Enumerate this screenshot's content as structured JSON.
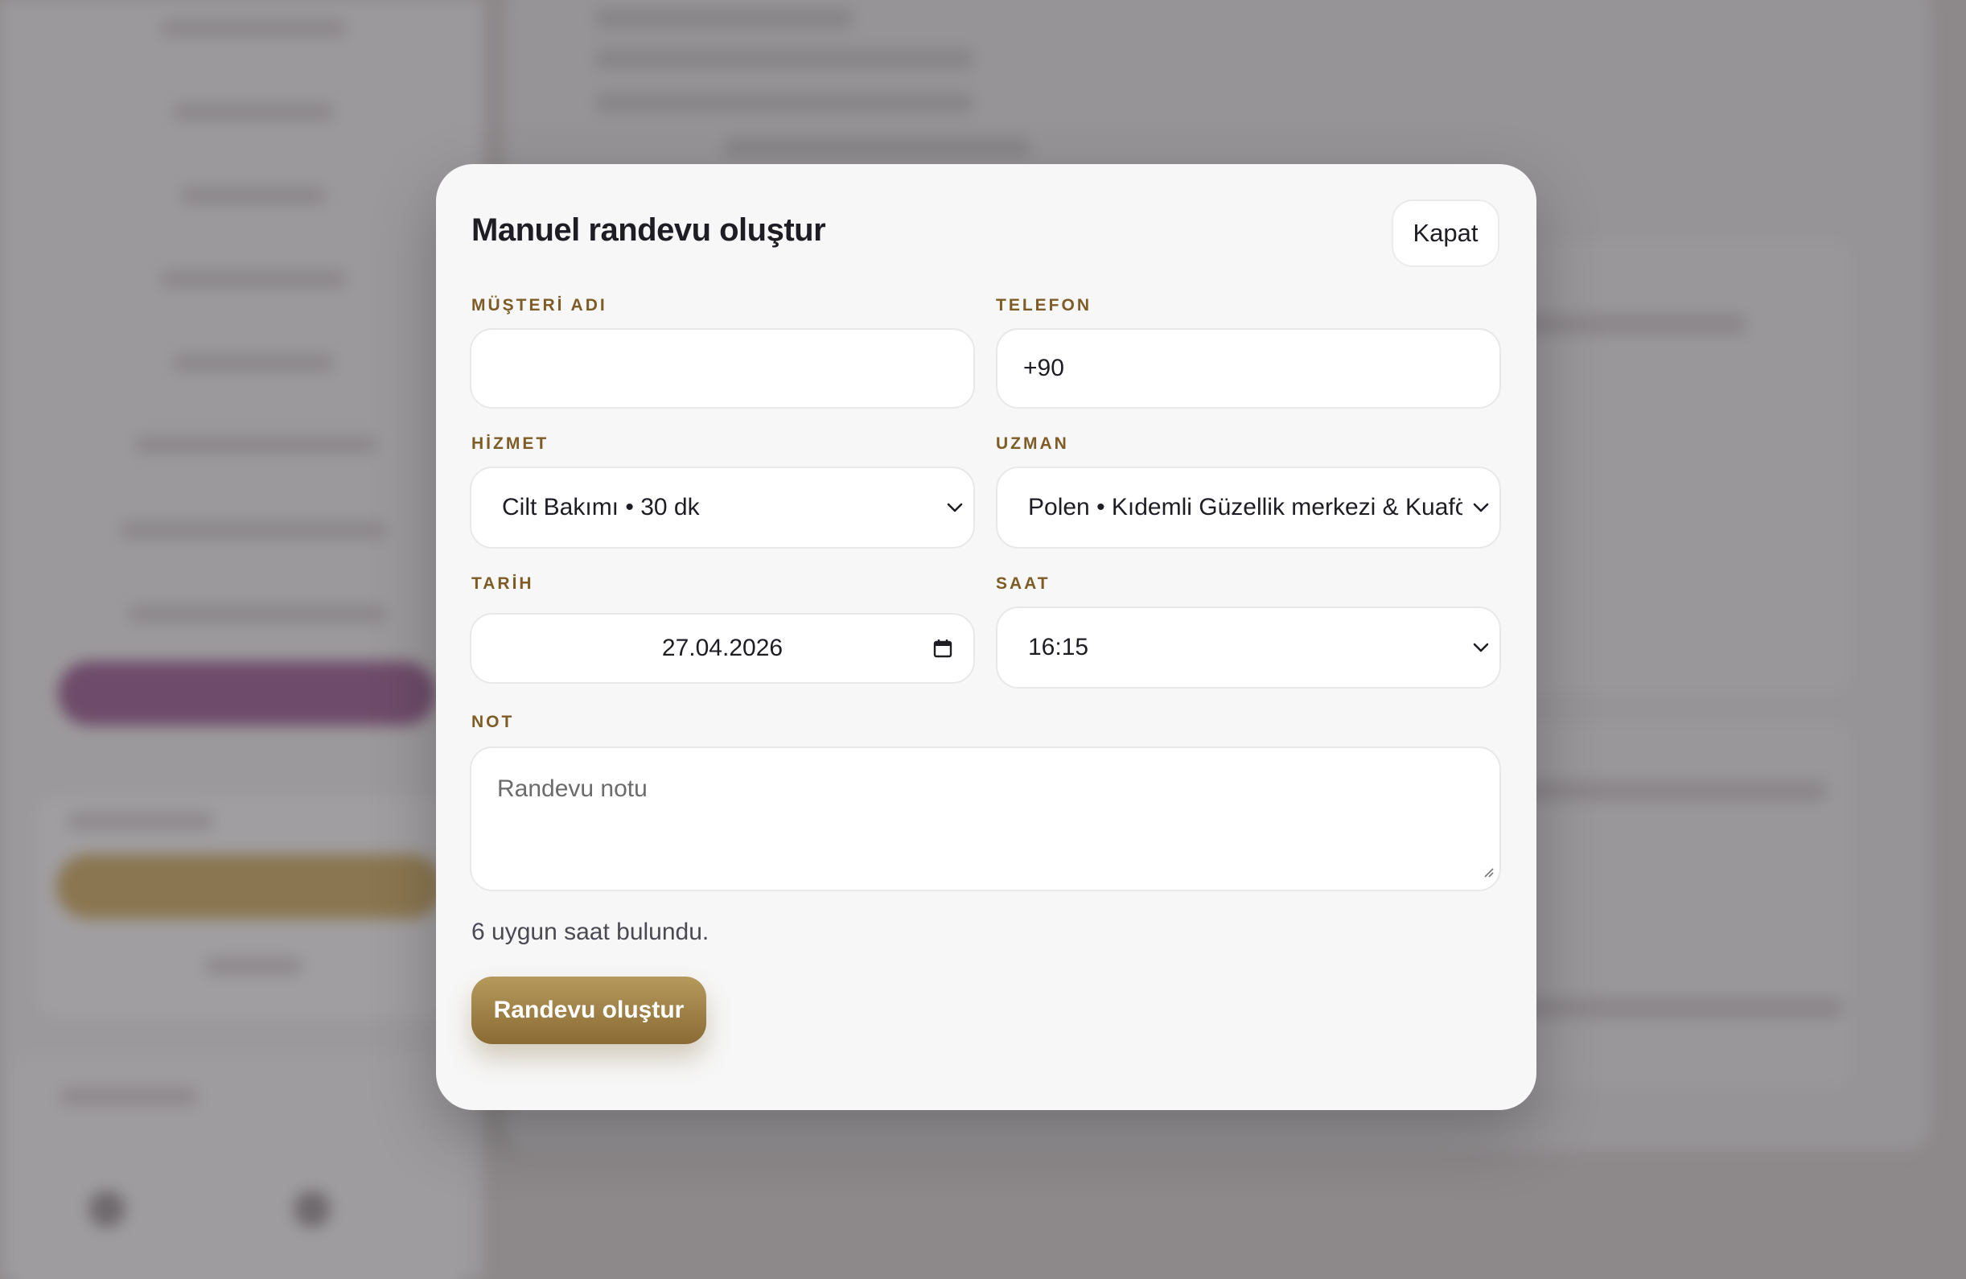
{
  "modal": {
    "title": "Manuel randevu oluştur",
    "close_label": "Kapat",
    "customer_name": {
      "label": "MÜŞTERİ ADI",
      "value": ""
    },
    "phone": {
      "label": "TELEFON",
      "value": "+90"
    },
    "service": {
      "label": "HİZMET",
      "value": "Cilt Bakımı • 30 dk"
    },
    "specialist": {
      "label": "UZMAN",
      "value": "Polen • Kıdemli Güzellik merkezi & Kuaför U"
    },
    "date": {
      "label": "TARİH",
      "value": "27.04.2026"
    },
    "time": {
      "label": "SAAT",
      "value": "16:15"
    },
    "note": {
      "label": "NOT",
      "placeholder": "Randevu notu"
    },
    "found_text": "6 uygun saat bulundu.",
    "submit_label": "Randevu oluştur"
  },
  "icons": [
    "chevron-down-icon",
    "calendar-icon",
    "resize-handle-icon"
  ],
  "colors": {
    "accent_label": "#7d5c26",
    "button_gradient_top": "#b69a5c",
    "button_gradient_bottom": "#8a6b35",
    "modal_background": "#f7f7f7",
    "overlay": "#8d898b"
  }
}
